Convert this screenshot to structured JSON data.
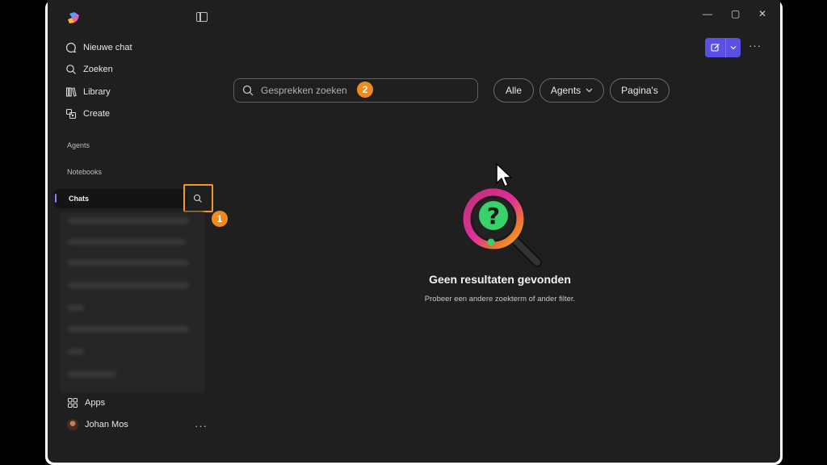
{
  "sidebar": {
    "nav": [
      {
        "label": "Nieuwe chat",
        "icon": "chat-bubble-icon"
      },
      {
        "label": "Zoeken",
        "icon": "search-icon"
      },
      {
        "label": "Library",
        "icon": "library-icon"
      },
      {
        "label": "Create",
        "icon": "create-icon"
      }
    ],
    "sections": {
      "agents": "Agents",
      "notebooks": "Notebooks",
      "chats": "Chats"
    },
    "apps_label": "Apps",
    "user_name": "Johan Mos"
  },
  "search": {
    "placeholder": "Gesprekken zoeken",
    "value": ""
  },
  "filters": {
    "all": "Alle",
    "agents": "Agents",
    "pages": "Pagina's"
  },
  "annotations": {
    "badge1": "1",
    "badge2": "2"
  },
  "empty_state": {
    "title": "Geen resultaten gevonden",
    "subtitle": "Probeer een andere zoekterm of ander filter."
  },
  "window_controls": {
    "minimize": "—",
    "maximize": "▢",
    "close": "✕"
  },
  "colors": {
    "accent": "#5a50e6",
    "highlight": "#f39a1a",
    "background": "#1f1f1f"
  }
}
